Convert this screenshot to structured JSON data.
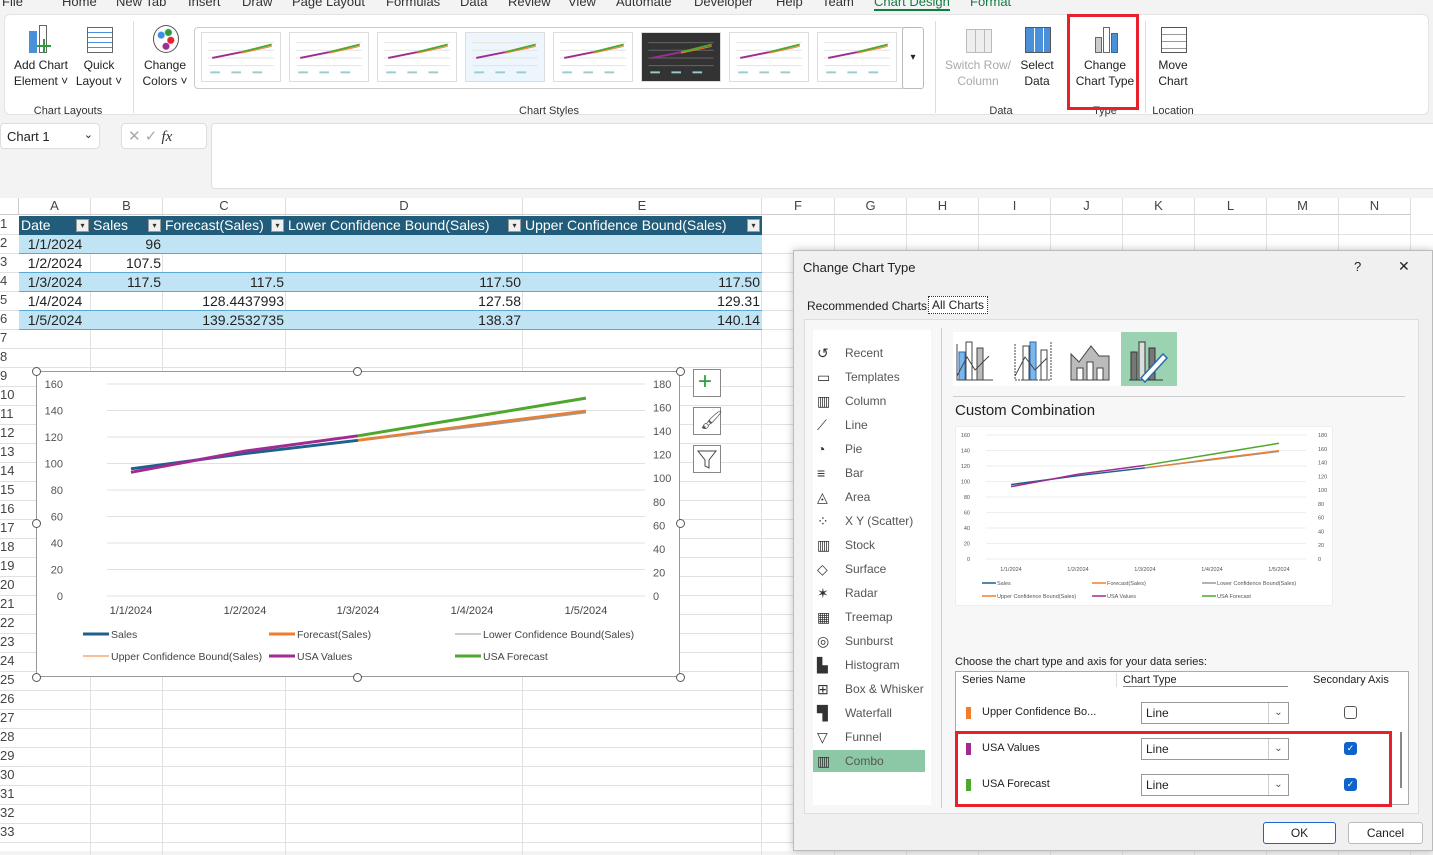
{
  "menu_tabs": [
    "File",
    "Home",
    "New Tab",
    "Insert",
    "Draw",
    "Page Layout",
    "Formulas",
    "Data",
    "Review",
    "View",
    "Automate",
    "Developer",
    "Help",
    "Team",
    "Chart Design",
    "Format"
  ],
  "active_tab": "Chart Design",
  "ribbon": {
    "add_chart_element": "Add Chart",
    "add_chart_element2": "Element ˅",
    "quick_layout": "Quick",
    "quick_layout2": "Layout ˅",
    "change_colors": "Change",
    "change_colors2": "Colors ˅",
    "chart_layouts_group": "Chart Layouts",
    "chart_styles_group": "Chart Styles",
    "switch_row": "Switch Row/",
    "switch_row2": "Column",
    "select_data": "Select",
    "select_data2": "Data",
    "data_group": "Data",
    "change_chart_type": "Change",
    "change_chart_type2": "Chart Type",
    "type_group": "Type",
    "move_chart": "Move",
    "move_chart2": "Chart",
    "location_group": "Location"
  },
  "namebox": "Chart 1",
  "formula_icons": {
    "cancel": "✕",
    "enter": "✓",
    "fx": "fx"
  },
  "columns": [
    "A",
    "B",
    "C",
    "D",
    "E",
    "F",
    "G",
    "H",
    "I",
    "J",
    "K",
    "L",
    "M",
    "N"
  ],
  "rows": [
    "1",
    "2",
    "3",
    "4",
    "5",
    "6",
    "7",
    "8",
    "9",
    "10",
    "11",
    "12",
    "13",
    "14",
    "15",
    "16",
    "17",
    "18",
    "19",
    "20",
    "21",
    "22",
    "23",
    "24",
    "25",
    "26",
    "27",
    "28",
    "29",
    "30",
    "31",
    "32",
    "33"
  ],
  "table": {
    "headers": [
      "Date",
      "Sales",
      "Forecast(Sales)",
      "Lower Confidence Bound(Sales)",
      "Upper Confidence Bound(Sales)"
    ],
    "rows": [
      [
        "1/1/2024",
        "96",
        "",
        "",
        ""
      ],
      [
        "1/2/2024",
        "107.5",
        "",
        "",
        ""
      ],
      [
        "1/3/2024",
        "117.5",
        "117.5",
        "117.50",
        "117.50"
      ],
      [
        "1/4/2024",
        "",
        "128.4437993",
        "127.58",
        "129.31"
      ],
      [
        "1/5/2024",
        "",
        "139.2532735",
        "138.37",
        "140.14"
      ]
    ]
  },
  "chart_data": {
    "type": "line",
    "categories": [
      "1/1/2024",
      "1/2/2024",
      "1/3/2024",
      "1/4/2024",
      "1/5/2024"
    ],
    "y_ticks": [
      "0",
      "20",
      "40",
      "60",
      "80",
      "100",
      "120",
      "140",
      "160"
    ],
    "y2_ticks": [
      "0",
      "20",
      "40",
      "60",
      "80",
      "100",
      "120",
      "140",
      "160",
      "180"
    ],
    "ylim": [
      0,
      160
    ],
    "y2lim": [
      0,
      180
    ],
    "grid": true,
    "legend_position": "bottom",
    "series": [
      {
        "name": "Sales",
        "axis": "primary",
        "color": "#1f5f8b",
        "values": [
          96,
          107.5,
          117.5,
          null,
          null
        ]
      },
      {
        "name": "Forecast(Sales)",
        "axis": "primary",
        "color": "#f07d2c",
        "values": [
          null,
          null,
          117.5,
          128.44,
          139.25
        ]
      },
      {
        "name": "Lower Confidence Bound(Sales)",
        "axis": "primary",
        "color": "#999999",
        "values": [
          null,
          null,
          117.5,
          127.58,
          138.37
        ]
      },
      {
        "name": "Upper Confidence Bound(Sales)",
        "axis": "primary",
        "color": "#f07d2c",
        "values": [
          null,
          null,
          117.5,
          129.31,
          140.14
        ]
      },
      {
        "name": "USA Values",
        "axis": "secondary",
        "color": "#a02b93",
        "values": [
          105,
          123,
          136,
          null,
          null
        ]
      },
      {
        "name": "USA Forecast",
        "axis": "secondary",
        "color": "#4ea72e",
        "values": [
          null,
          null,
          136,
          152,
          168
        ]
      }
    ]
  },
  "dialog": {
    "title": "Change Chart Type",
    "help": "?",
    "close": "✕",
    "tabs": [
      "Recommended Charts",
      "All Charts"
    ],
    "chart_types": [
      "Recent",
      "Templates",
      "Column",
      "Line",
      "Pie",
      "Bar",
      "Area",
      "X Y (Scatter)",
      "Stock",
      "Surface",
      "Radar",
      "Treemap",
      "Sunburst",
      "Histogram",
      "Box & Whisker",
      "Waterfall",
      "Funnel",
      "Combo"
    ],
    "selected_type": "Combo",
    "subtype_title": "Custom Combination",
    "series_prompt": "Choose the chart type and axis for your data series:",
    "grid_headers": [
      "Series Name",
      "Chart Type",
      "Secondary Axis"
    ],
    "series_rows": [
      {
        "name": "Upper Confidence Bo...",
        "color": "#f07d2c",
        "type": "Line",
        "secondary": false
      },
      {
        "name": "USA Values",
        "color": "#a02b93",
        "type": "Line",
        "secondary": true
      },
      {
        "name": "USA Forecast",
        "color": "#4ea72e",
        "type": "Line",
        "secondary": true
      }
    ],
    "ok": "OK",
    "cancel": "Cancel"
  }
}
